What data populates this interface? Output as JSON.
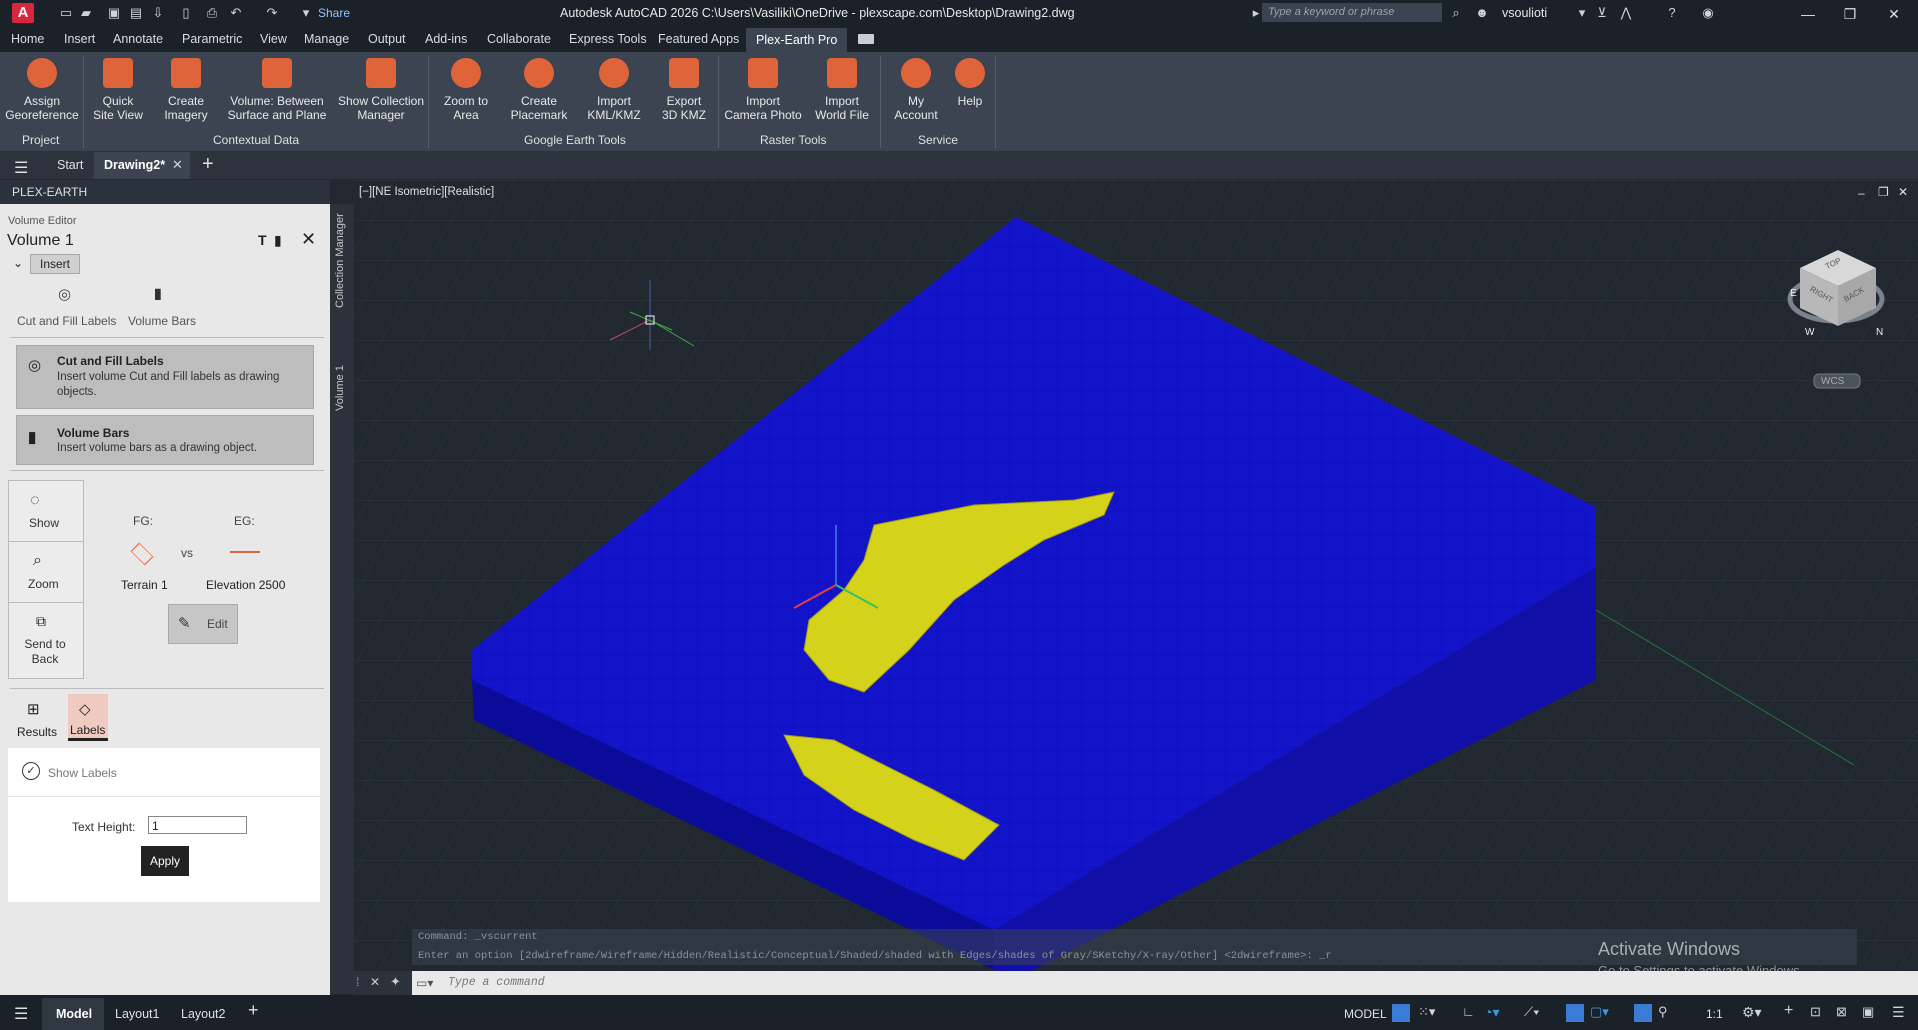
{
  "title_bar": {
    "app_letter": "A",
    "share": "Share",
    "title": "Autodesk AutoCAD 2026    C:\\Users\\Vasiliki\\OneDrive - plexscape.com\\Desktop\\Drawing2.dwg",
    "search_placeholder": "Type a keyword or phrase",
    "username": "vsoulioti"
  },
  "menu_tabs": [
    "Home",
    "Insert",
    "Annotate",
    "Parametric",
    "View",
    "Manage",
    "Output",
    "Add-ins",
    "Collaborate",
    "Express Tools",
    "Featured Apps"
  ],
  "active_menu_tab": "Plex-Earth Pro",
  "ribbon": {
    "buttons": [
      "Assign\nGeoreference",
      "Quick\nSite View",
      "Create\nImagery",
      "Volume: Between\nSurface and Plane",
      "Show Collection\nManager",
      "Zoom to\nArea",
      "Create\nPlacemark",
      "Import\nKML/KMZ",
      "Export\n3D KMZ",
      "Import\nCamera Photo",
      "Import\nWorld File",
      "My\nAccount",
      "Help"
    ],
    "panels": [
      "Project",
      "Contextual Data",
      "Google Earth Tools",
      "Raster Tools",
      "Service"
    ]
  },
  "file_tabs": {
    "start": "Start",
    "drawing": "Drawing2*"
  },
  "left_panel": {
    "header": "PLEX-EARTH",
    "editor_label": "Volume Editor",
    "volume_name": "Volume 1",
    "insert_label": "Insert",
    "insert_items": [
      "Cut and Fill Labels",
      "Volume Bars"
    ],
    "cards": [
      {
        "title": "Cut and Fill Labels",
        "desc": "Insert volume Cut and Fill labels as drawing objects."
      },
      {
        "title": "Volume Bars",
        "desc": "Insert volume bars as a drawing object."
      }
    ],
    "side_buttons": [
      "Show",
      "Zoom",
      "Send to Back"
    ],
    "fg_label": "FG:",
    "eg_label": "EG:",
    "vs": "vs",
    "fg_name": "Terrain 1",
    "eg_name": "Elevation 2500",
    "edit": "Edit",
    "bottom_tabs": [
      "Results",
      "Labels"
    ],
    "show_labels": "Show Labels",
    "text_height_label": "Text Height:",
    "text_height_value": "1",
    "apply": "Apply"
  },
  "vertical_tabs": [
    "Collection Manager",
    "Volume 1"
  ],
  "viewport": {
    "label": "[−][NE Isometric][Realistic]",
    "wcs": "WCS",
    "viewcube": {
      "top": "TOP",
      "right": "RIGHT",
      "back": "BACK"
    },
    "compass": {
      "e": "E",
      "n": "N",
      "w": "W"
    },
    "watermark_title": "Activate Windows",
    "watermark_sub": "Go to Settings to activate Windows."
  },
  "command": {
    "history1": "Command: _vscurrent",
    "history2": "Enter an option [2dwireframe/Wireframe/Hidden/Realistic/Conceptual/Shaded/shaded with Edges/shades of Gray/SKetchy/X-ray/Other] <2dwireframe>: _r",
    "placeholder": "Type a command"
  },
  "status_bar": {
    "tabs": [
      "Model",
      "Layout1",
      "Layout2"
    ],
    "model": "MODEL",
    "scale": "1:1"
  },
  "colors": {
    "accent_orange": "#e0643a",
    "volume_blue": "#1414c8",
    "cut_yellow": "#d4d21a"
  }
}
